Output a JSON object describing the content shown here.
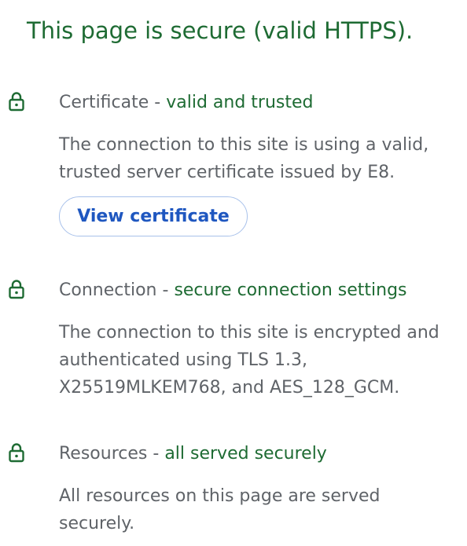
{
  "headline": "This page is secure (valid HTTPS).",
  "colors": {
    "secure_green": "#1e6b33",
    "muted_text": "#5f6368",
    "link_blue": "#1f57c0",
    "button_border": "#a8c1ea"
  },
  "certificate": {
    "icon": "lock-icon",
    "name": "Certificate",
    "separator": "-",
    "status": "valid and trusted",
    "description_lines": [
      "The connection to this site is using a valid,",
      "trusted server certificate issued by E8."
    ],
    "button_label": "View certificate"
  },
  "connection": {
    "icon": "lock-icon",
    "name": "Connection",
    "separator": "-",
    "status": "secure connection settings",
    "description_lines": [
      "The connection to this site is encrypted and",
      "authenticated using TLS 1.3,",
      "X25519MLKEM768, and AES_128_GCM."
    ]
  },
  "resources": {
    "icon": "lock-icon",
    "name": "Resources",
    "separator": "-",
    "status": "all served securely",
    "description_lines": [
      "All resources on this page are served",
      "securely."
    ]
  }
}
